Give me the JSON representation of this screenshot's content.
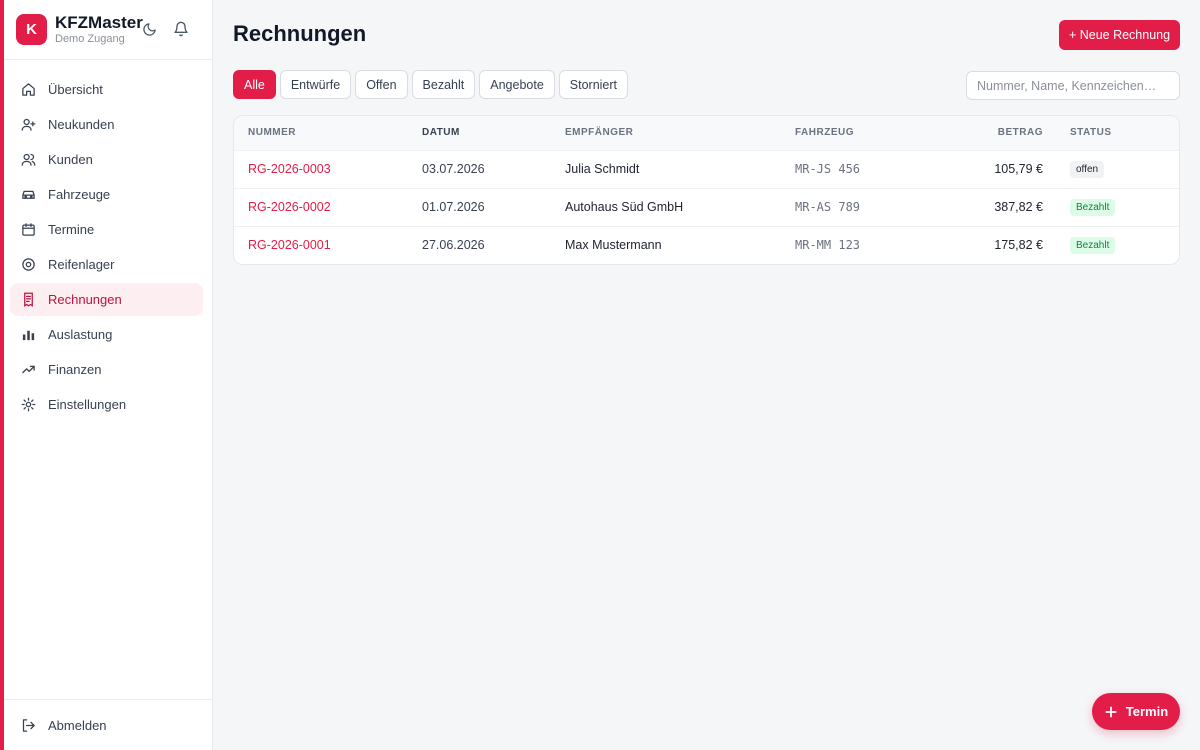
{
  "brand": {
    "logo_letter": "K",
    "name": "KFZMaster",
    "subtitle": "Demo Zugang"
  },
  "sidebar": {
    "items": [
      {
        "label": "Übersicht",
        "icon": "home-icon"
      },
      {
        "label": "Neukunden",
        "icon": "user-plus-icon"
      },
      {
        "label": "Kunden",
        "icon": "users-icon"
      },
      {
        "label": "Fahrzeuge",
        "icon": "car-icon"
      },
      {
        "label": "Termine",
        "icon": "calendar-icon"
      },
      {
        "label": "Reifenlager",
        "icon": "tire-icon"
      },
      {
        "label": "Rechnungen",
        "icon": "receipt-icon",
        "active": true
      },
      {
        "label": "Auslastung",
        "icon": "bar-chart-icon"
      },
      {
        "label": "Finanzen",
        "icon": "trending-up-icon"
      },
      {
        "label": "Einstellungen",
        "icon": "gear-icon"
      }
    ],
    "logout_label": "Abmelden"
  },
  "page": {
    "title": "Rechnungen",
    "new_button": "+ Neue Rechnung"
  },
  "filters": [
    "Alle",
    "Entwürfe",
    "Offen",
    "Bezahlt",
    "Angebote",
    "Storniert"
  ],
  "active_filter": "Alle",
  "search": {
    "placeholder": "Nummer, Name, Kennzeichen…"
  },
  "table": {
    "headers": {
      "number": "Nummer",
      "date": "Datum",
      "recipient": "Empfänger",
      "vehicle": "Fahrzeug",
      "amount": "Betrag",
      "status": "Status"
    },
    "rows": [
      {
        "number": "RG-2026-0003",
        "date": "03.07.2026",
        "recipient": "Julia Schmidt",
        "vehicle": "MR-JS 456",
        "amount": "105,79 €",
        "status": "offen"
      },
      {
        "number": "RG-2026-0002",
        "date": "01.07.2026",
        "recipient": "Autohaus Süd GmbH",
        "vehicle": "MR-AS 789",
        "amount": "387,82 €",
        "status": "Bezahlt"
      },
      {
        "number": "RG-2026-0001",
        "date": "27.06.2026",
        "recipient": "Max Mustermann",
        "vehicle": "MR-MM 123",
        "amount": "175,82 €",
        "status": "Bezahlt"
      }
    ]
  },
  "fab": {
    "label": "Termin"
  },
  "colors": {
    "accent": "#e11d48",
    "paid_badge": "#dcfce7",
    "paid_text": "#15803d"
  }
}
